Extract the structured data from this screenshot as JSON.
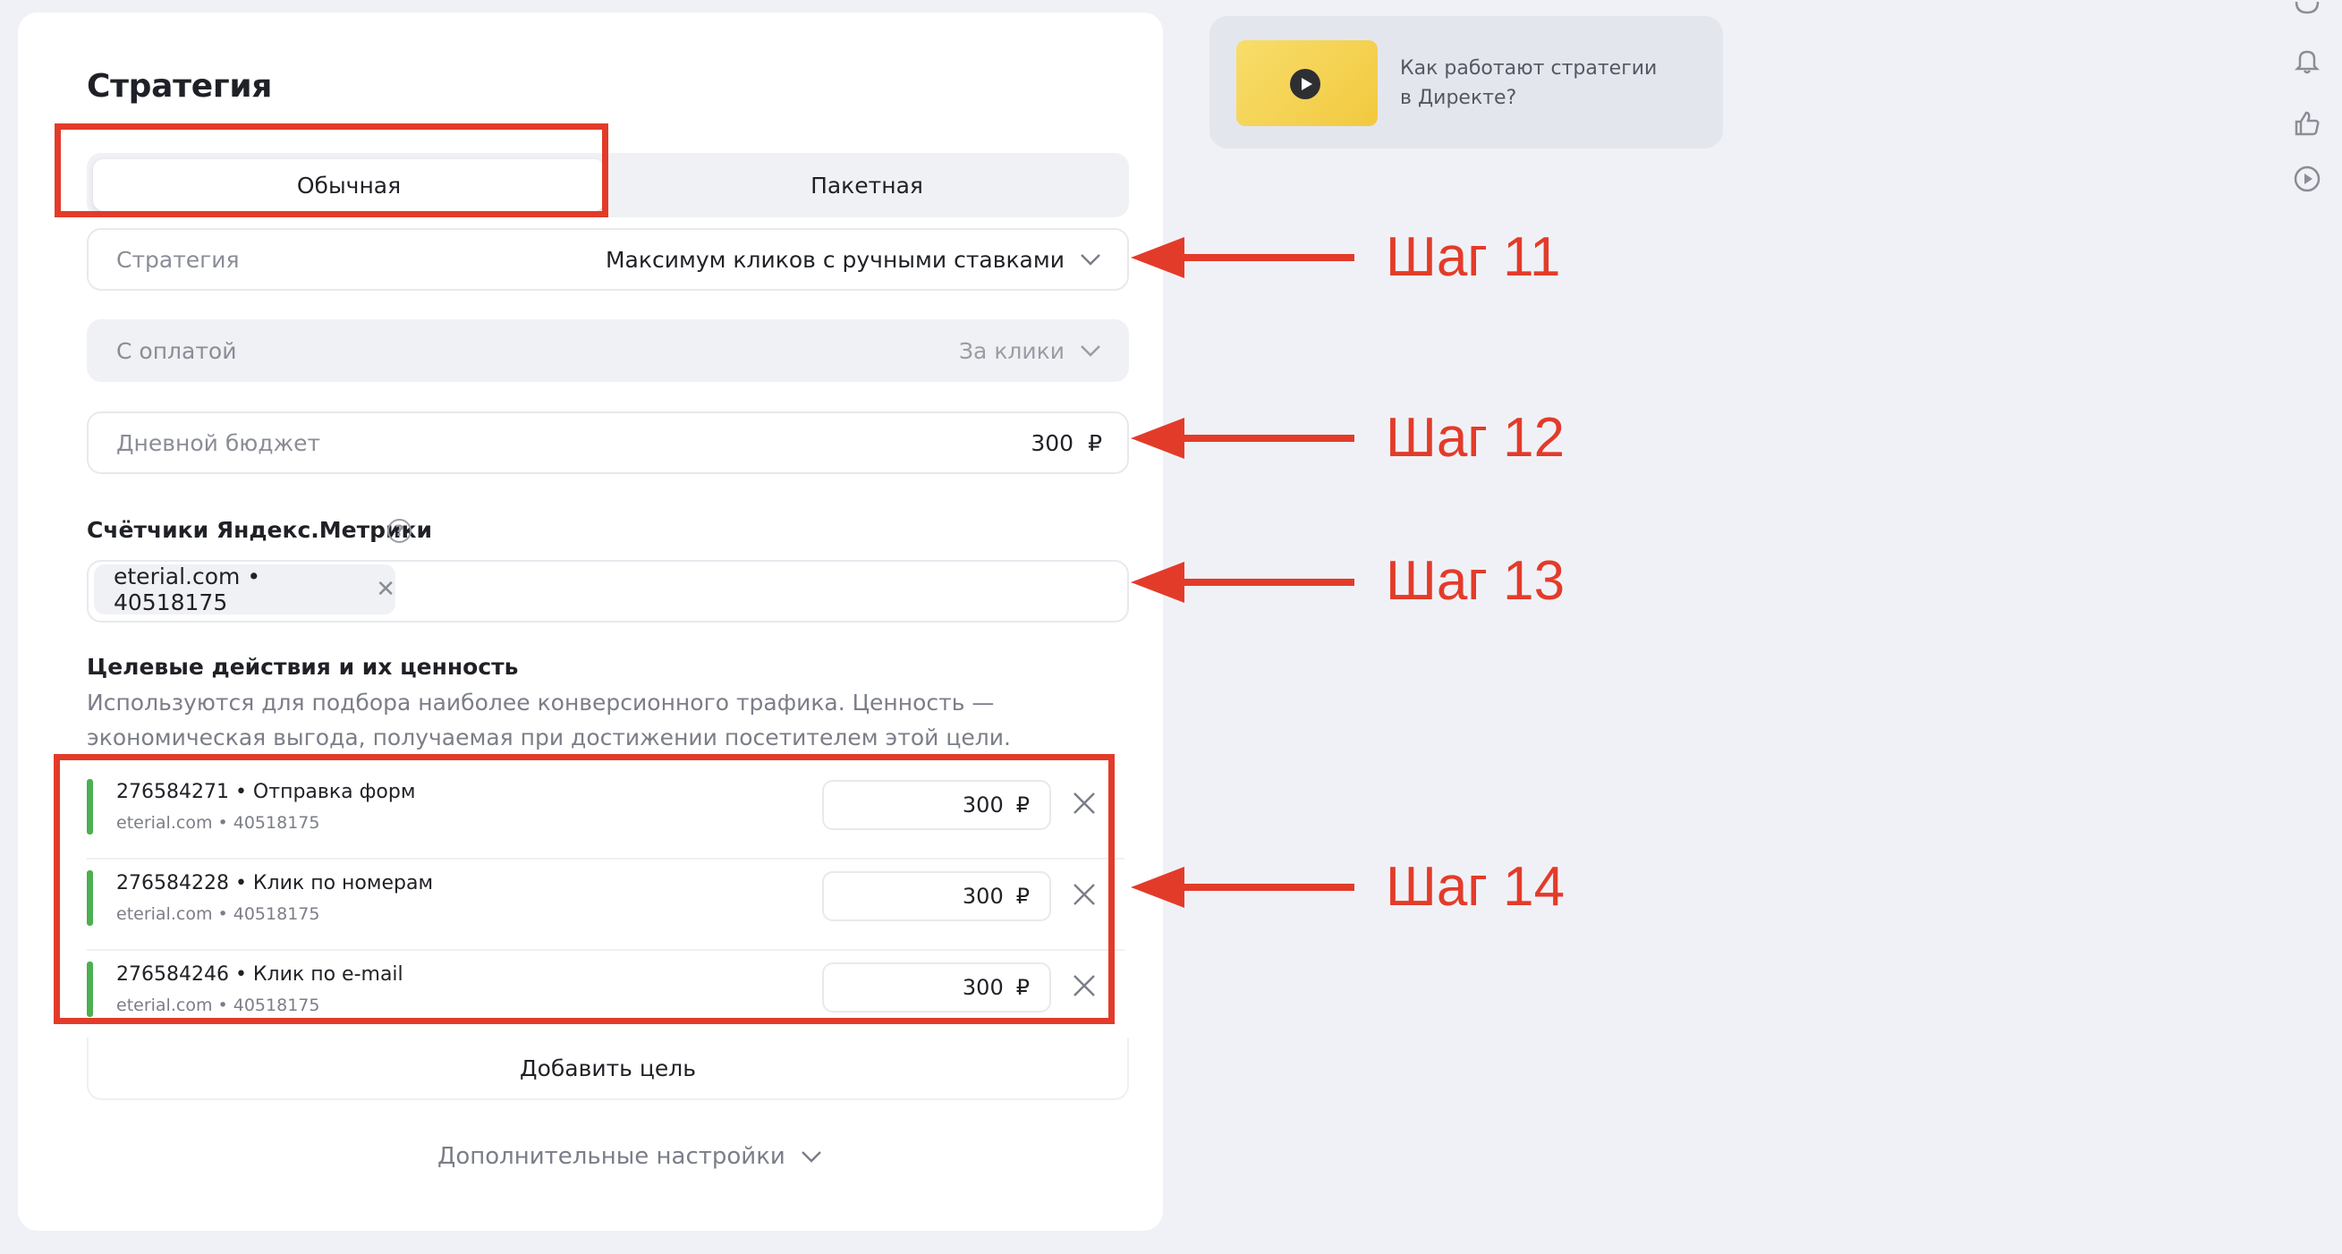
{
  "strategy_card": {
    "title": "Стратегия",
    "tabs": {
      "regular": "Обычная",
      "package": "Пакетная"
    },
    "strategy": {
      "label": "Стратегия",
      "value": "Максимум кликов с ручными ставками"
    },
    "payment": {
      "label": "С оплатой",
      "value": "За клики"
    },
    "daily_budget": {
      "label": "Дневной бюджет",
      "value": "300",
      "currency": "₽"
    },
    "metrika": {
      "label": "Счётчики Яндекс.Метрики",
      "help": "?",
      "chip": "eterial.com • 40518175",
      "chip_remove": "✕"
    },
    "goals": {
      "label": "Целевые действия и их ценность",
      "description": "Используются для подбора наиболее конверсионного трафика. Ценность — экономическая выгода, получаемая при достижении посетителем этой цели.",
      "items": [
        {
          "name": "276584271 • Отправка форм",
          "site": "eterial.com • 40518175",
          "value": "300",
          "currency": "₽"
        },
        {
          "name": "276584228 • Клик по номерам",
          "site": "eterial.com • 40518175",
          "value": "300",
          "currency": "₽"
        },
        {
          "name": "276584246 • Клик по e-mail",
          "site": "eterial.com • 40518175",
          "value": "300",
          "currency": "₽"
        }
      ],
      "add_label": "Добавить цель"
    },
    "more_settings": "Дополнительные настройки"
  },
  "annotations": {
    "step11": "Шаг 11",
    "step12": "Шаг 12",
    "step13": "Шаг 13",
    "step14": "Шаг 14",
    "color": "#e33b2a"
  },
  "promo": {
    "line1": "Как работают стратегии",
    "line2": "в Директе?"
  },
  "colors": {
    "accent_green": "#4caf50",
    "background": "#f0f1f6"
  },
  "icons": [
    "chevron-down-icon",
    "close-icon",
    "help-icon",
    "play-icon",
    "chat-icon",
    "bell-icon",
    "like-icon",
    "play-circle-icon"
  ]
}
